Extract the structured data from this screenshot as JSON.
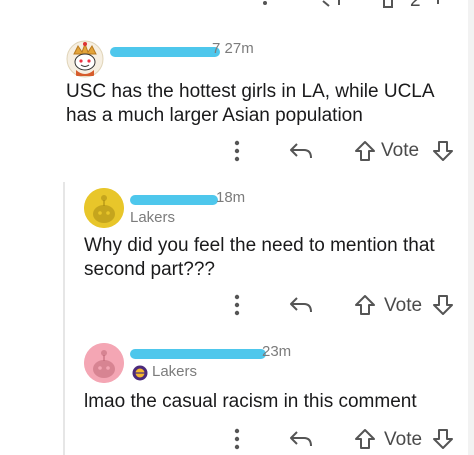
{
  "comments": [
    {
      "time": "7 27m",
      "body": "USC has the hottest girls in LA, while UCLA has a much larger Asian population",
      "vote_label": "Vote"
    },
    {
      "time": "18m",
      "flair": "Lakers",
      "body": "Why did you feel the need to mention that second part???",
      "vote_label": "Vote"
    },
    {
      "time": "23m",
      "flair": "Lakers",
      "body": "lmao the casual racism in this comment",
      "vote_label": "Vote"
    }
  ],
  "top_partial": {
    "count": "2"
  },
  "colors": {
    "redaction": "#3fc2ea",
    "avatar_yellow": "#e8c62a",
    "avatar_pink": "#f4a6b4"
  }
}
